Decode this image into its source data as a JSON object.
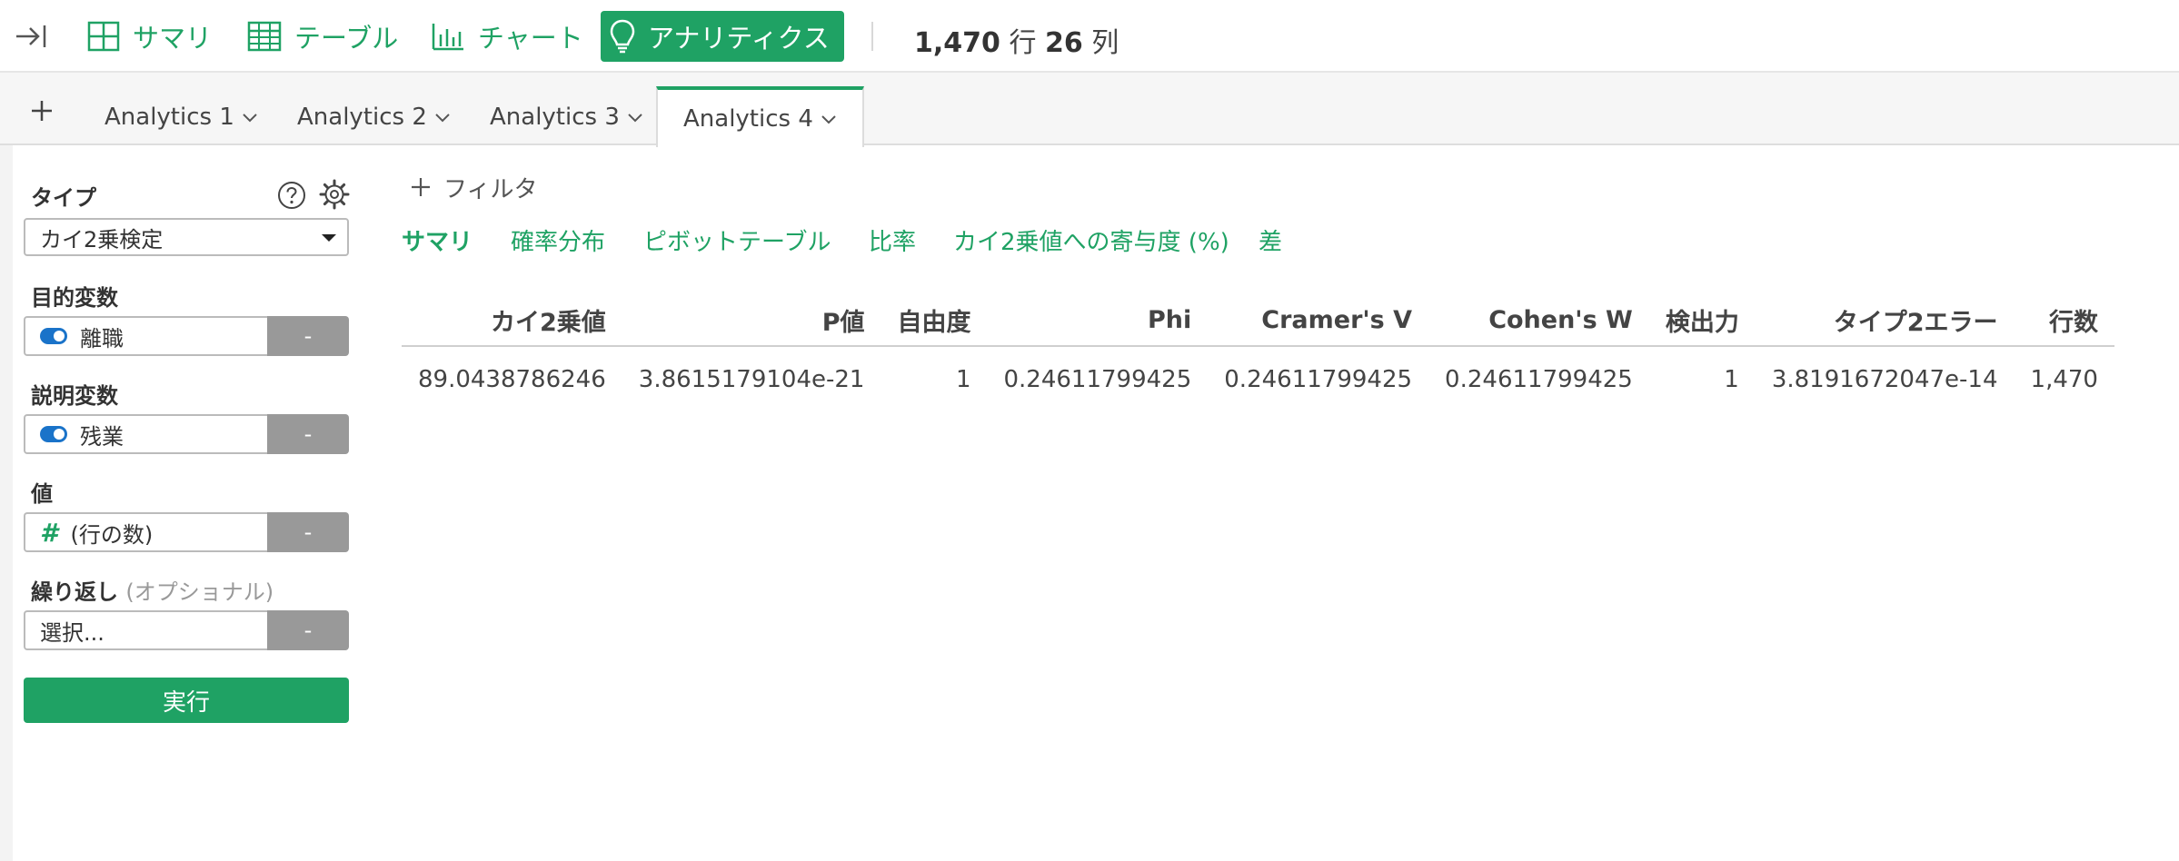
{
  "toolbar": {
    "buttons": [
      {
        "label": "サマリ",
        "icon": "grid-icon"
      },
      {
        "label": "テーブル",
        "icon": "table-icon"
      },
      {
        "label": "チャート",
        "icon": "bar-chart-icon"
      },
      {
        "label": "アナリティクス",
        "icon": "lightbulb-icon"
      }
    ],
    "rows_count": "1,470",
    "rows_unit": "行",
    "cols_count": "26",
    "cols_unit": "列",
    "accent_color": "#1fa264"
  },
  "tabs": [
    {
      "label": "Analytics 1"
    },
    {
      "label": "Analytics 2"
    },
    {
      "label": "Analytics 3"
    },
    {
      "label": "Analytics 4"
    }
  ],
  "sidebar": {
    "type_label": "タイプ",
    "type_value": "カイ2乗検定",
    "target_label": "目的変数",
    "target_value": "離職",
    "explanatory_label": "説明変数",
    "explanatory_value": "残業",
    "value_label": "値",
    "value_value": "(行の数)",
    "repeat_label": "繰り返し",
    "repeat_optional": "(オプショナル)",
    "repeat_placeholder": "選択...",
    "remove_label": "-",
    "run_label": "実行"
  },
  "main": {
    "filter_label": "フィルタ",
    "subtabs": [
      "サマリ",
      "確率分布",
      "ピボットテーブル",
      "比率",
      "カイ2乗値への寄与度 (%)",
      "差"
    ],
    "table": {
      "headers": [
        "カイ2乗値",
        "P値",
        "自由度",
        "Phi",
        "Cramer's V",
        "Cohen's W",
        "検出力",
        "タイプ2エラー",
        "行数"
      ],
      "rows": [
        [
          "89.0438786246",
          "3.8615179104e-21",
          "1",
          "0.24611799425",
          "0.24611799425",
          "0.24611799425",
          "1",
          "3.8191672047e-14",
          "1,470"
        ]
      ]
    }
  }
}
